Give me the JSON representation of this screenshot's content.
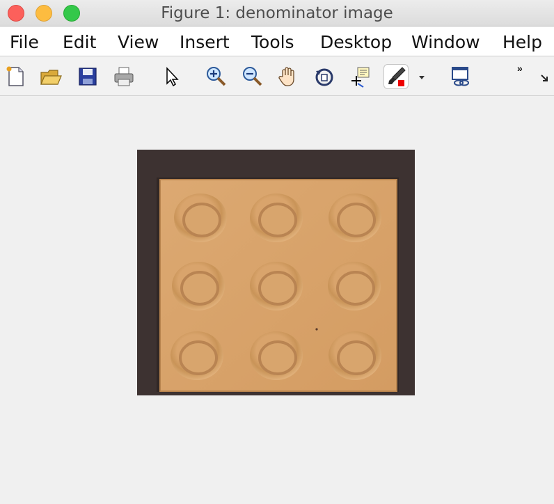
{
  "window": {
    "title": "Figure 1: denominator image"
  },
  "menu": {
    "items": [
      "File",
      "Edit",
      "View",
      "Insert",
      "Tools",
      "Desktop",
      "Window",
      "Help"
    ]
  },
  "toolbar": {
    "icons": [
      "new-figure-icon",
      "open-file-icon",
      "save-icon",
      "print-icon",
      "edit-plot-arrow-icon",
      "zoom-in-icon",
      "zoom-out-icon",
      "pan-hand-icon",
      "rotate-3d-icon",
      "data-cursor-icon",
      "brush-icon",
      "brush-dropdown-icon",
      "link-plot-icon",
      "overflow-chevron-icon",
      "dock-arrow-icon"
    ],
    "overflow_label": "»"
  },
  "image": {
    "description_colors": {
      "background": "#3b3030",
      "plate": "#d9a46c",
      "ring_shadow": "#b98452"
    }
  }
}
